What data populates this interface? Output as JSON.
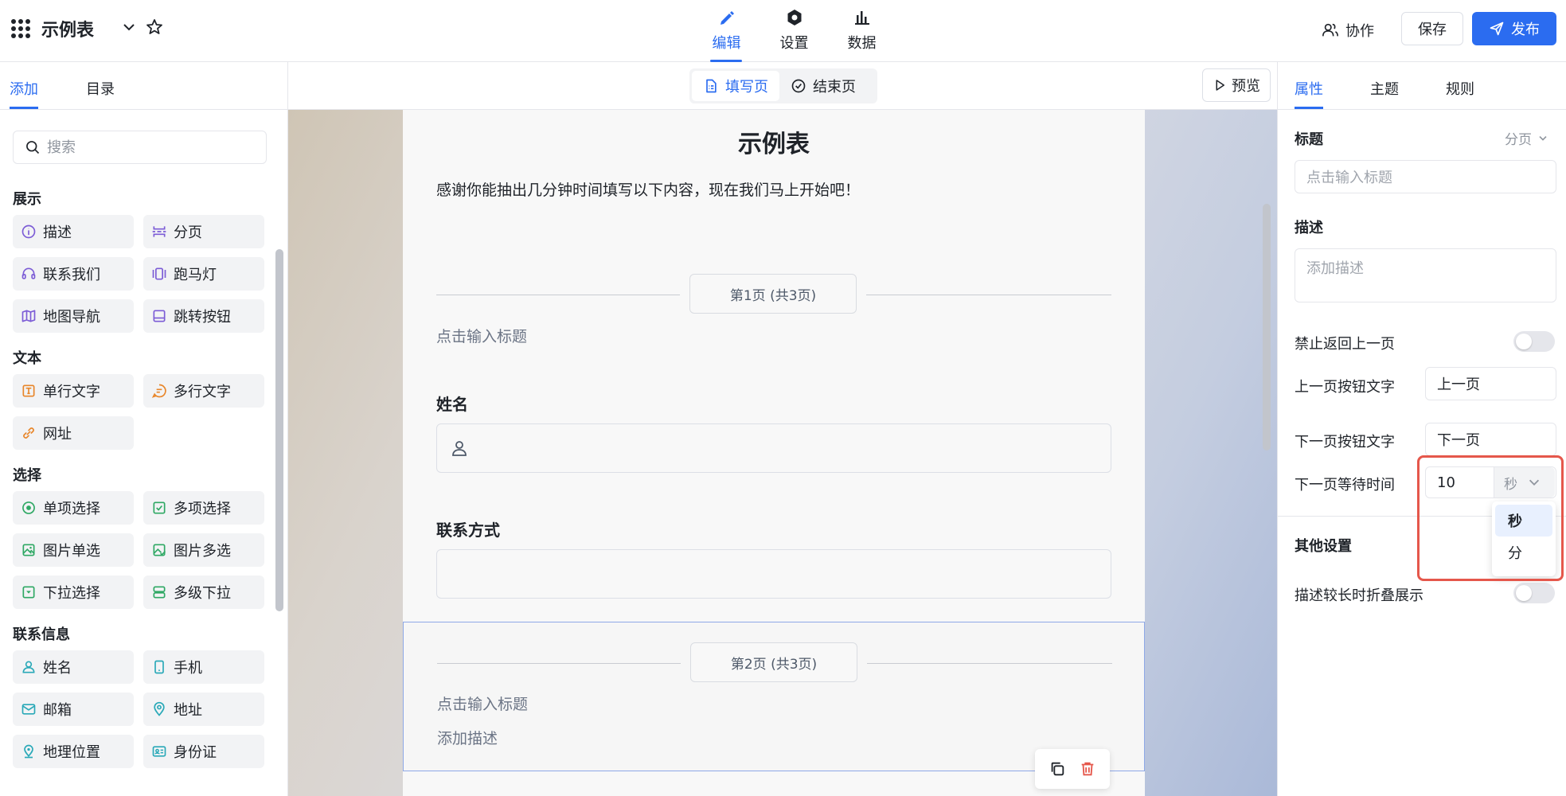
{
  "header": {
    "title": "示例表",
    "nav": [
      {
        "label": "编辑",
        "icon": "pen-icon"
      },
      {
        "label": "设置",
        "icon": "hexagon-icon"
      },
      {
        "label": "数据",
        "icon": "bar-chart-icon"
      }
    ],
    "collab_label": "协作",
    "save_label": "保存",
    "publish_label": "发布",
    "accent": "#2b6cf0"
  },
  "left": {
    "tabs": [
      "添加",
      "目录"
    ],
    "search_placeholder": "搜索",
    "sections": [
      {
        "title": "展示",
        "items": [
          {
            "label": "描述",
            "icon": "info-icon"
          },
          {
            "label": "分页",
            "icon": "pagebreak-icon"
          },
          {
            "label": "联系我们",
            "icon": "headset-icon"
          },
          {
            "label": "跑马灯",
            "icon": "carousel-icon"
          },
          {
            "label": "地图导航",
            "icon": "map-icon"
          },
          {
            "label": "跳转按钮",
            "icon": "button-icon"
          }
        ]
      },
      {
        "title": "文本",
        "items": [
          {
            "label": "单行文字",
            "icon": "text-line-icon"
          },
          {
            "label": "多行文字",
            "icon": "chat-icon"
          },
          {
            "label": "网址",
            "icon": "link-icon"
          }
        ]
      },
      {
        "title": "选择",
        "items": [
          {
            "label": "单项选择",
            "icon": "radio-icon"
          },
          {
            "label": "多项选择",
            "icon": "checkbox-icon"
          },
          {
            "label": "图片单选",
            "icon": "image-icon"
          },
          {
            "label": "图片多选",
            "icon": "image-multi-icon"
          },
          {
            "label": "下拉选择",
            "icon": "dropdown-icon"
          },
          {
            "label": "多级下拉",
            "icon": "cascade-icon"
          }
        ]
      },
      {
        "title": "联系信息",
        "items": [
          {
            "label": "姓名",
            "icon": "person-icon"
          },
          {
            "label": "手机",
            "icon": "phone-icon"
          },
          {
            "label": "邮箱",
            "icon": "mail-icon"
          },
          {
            "label": "地址",
            "icon": "location-icon"
          },
          {
            "label": "地理位置",
            "icon": "pin-icon"
          },
          {
            "label": "身份证",
            "icon": "id-card-icon"
          }
        ]
      }
    ]
  },
  "center": {
    "toggle": [
      "填写页",
      "结束页"
    ],
    "preview_label": "预览",
    "form_title": "示例表",
    "form_desc": "感谢你能抽出几分钟时间填写以下内容，现在我们马上开始吧！",
    "page1_label": "第1页 (共3页)",
    "page1_title_placeholder": "点击输入标题",
    "field_name_label": "姓名",
    "field_contact_label": "联系方式",
    "page2_label": "第2页 (共3页)",
    "page2_title_placeholder": "点击输入标题",
    "page2_desc_placeholder": "添加描述"
  },
  "right": {
    "tabs": [
      "属性",
      "主题",
      "规则"
    ],
    "title_label": "标题",
    "paging_value": "分页",
    "title_placeholder": "点击输入标题",
    "desc_label": "描述",
    "desc_placeholder": "添加描述",
    "no_back_label": "禁止返回上一页",
    "prev_btn_label": "上一页按钮文字",
    "prev_btn_value": "上一页",
    "next_btn_label": "下一页按钮文字",
    "next_btn_value": "下一页",
    "wait_label": "下一页等待时间",
    "wait_value": "10",
    "wait_unit": "秒",
    "unit_options": [
      "秒",
      "分"
    ],
    "other_label": "其他设置",
    "collapse_label": "描述较长时折叠展示"
  }
}
